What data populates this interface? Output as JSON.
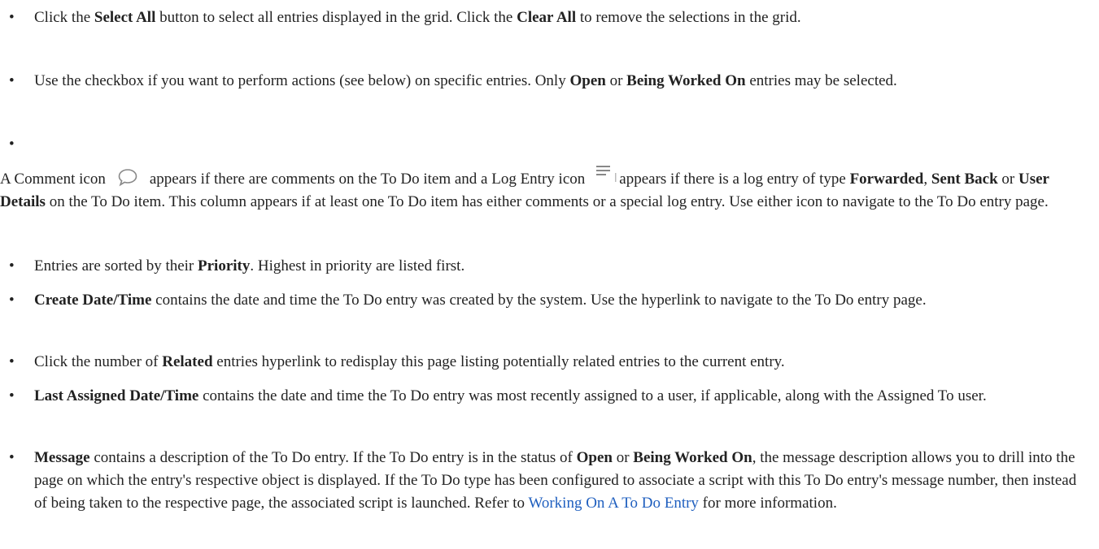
{
  "items": [
    {
      "id": "select-all",
      "segments": [
        {
          "t": "Click the "
        },
        {
          "t": "Select All",
          "b": true
        },
        {
          "t": " button to select all entries displayed in the grid. Click the "
        },
        {
          "t": "Clear All",
          "b": true
        },
        {
          "t": " to remove the selections in the grid."
        }
      ]
    },
    {
      "id": "checkbox",
      "segments": [
        {
          "t": "Use the checkbox if you want to perform actions (see below) on specific entries. Only "
        },
        {
          "t": "Open",
          "b": true
        },
        {
          "t": " or "
        },
        {
          "t": "Being Worked On",
          "b": true
        },
        {
          "t": " entries may be selected."
        }
      ]
    },
    {
      "id": "icons",
      "segments": [
        {
          "t": "A Comment icon"
        },
        {
          "icon": "comment-icon"
        },
        {
          "t": "appears if there are comments on the To Do item and a Log Entry icon"
        },
        {
          "icon": "log-entry-icon"
        },
        {
          "t": "appears if there is a log entry of type "
        },
        {
          "t": "Forwarded",
          "b": true
        },
        {
          "t": ", "
        },
        {
          "t": "Sent Back",
          "b": true
        },
        {
          "t": " or "
        },
        {
          "t": "User Details",
          "b": true
        },
        {
          "t": " on the To Do item. This column appears if at least one To Do item has either comments or a special log entry. Use either icon to navigate to the To Do entry page."
        }
      ]
    },
    {
      "id": "priority",
      "segments": [
        {
          "t": "Entries are sorted by their "
        },
        {
          "t": "Priority",
          "b": true
        },
        {
          "t": ". Highest in priority are listed first."
        }
      ]
    },
    {
      "id": "create-date",
      "segments": [
        {
          "t": "Create Date/Time",
          "b": true
        },
        {
          "t": " contains the date and time the To Do entry was created by the system. Use the hyperlink to navigate to the To Do entry page."
        }
      ]
    },
    {
      "id": "related",
      "segments": [
        {
          "t": "Click the number of "
        },
        {
          "t": "Related",
          "b": true
        },
        {
          "t": " entries hyperlink to redisplay this page listing potentially related entries to the current entry."
        }
      ]
    },
    {
      "id": "last-assigned",
      "segments": [
        {
          "t": "Last Assigned Date/Time",
          "b": true
        },
        {
          "t": " contains the date and time the To Do entry was most recently assigned to a user, if applicable, along with the Assigned To user."
        }
      ]
    },
    {
      "id": "message",
      "segments": [
        {
          "t": "Message",
          "b": true
        },
        {
          "t": " contains a description of the To Do entry. If the To Do entry is in the status of "
        },
        {
          "t": "Open",
          "b": true
        },
        {
          "t": " or "
        },
        {
          "t": "Being Worked On",
          "b": true
        },
        {
          "t": ", the message description allows you to drill into the page on which the entry's respective object is displayed. If the To Do type has been configured to associate a script with this To Do entry's message number, then instead of being taken to the respective page, the associated script is launched. Refer to "
        },
        {
          "t": "Working On A To Do Entry",
          "link": true
        },
        {
          "t": " for more information."
        }
      ]
    }
  ],
  "colors": {
    "text": "#222222",
    "link": "#1f5fbf",
    "icon": "#888888"
  }
}
